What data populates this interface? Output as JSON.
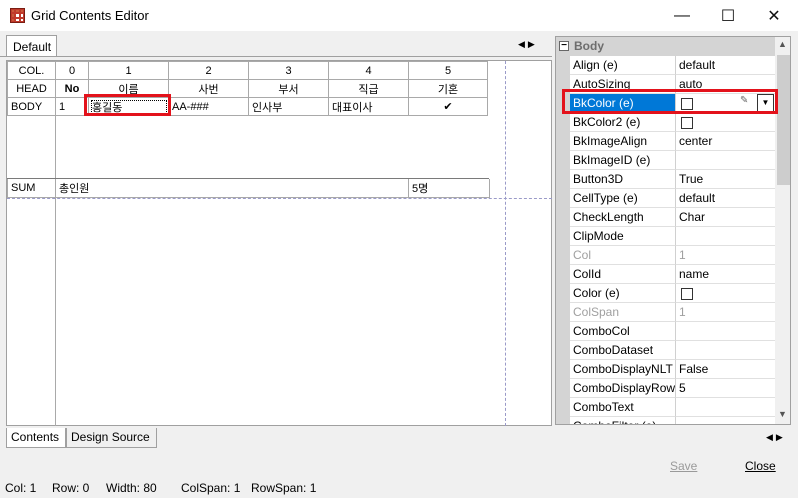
{
  "window": {
    "title": "Grid Contents Editor",
    "minimize": "—",
    "maximize": "☐",
    "close": "✕"
  },
  "top_tabs": [
    "Default"
  ],
  "grid": {
    "col_header_label": "COL.",
    "head_label": "HEAD",
    "body_label": "BODY",
    "sum_label": "SUM",
    "col_numbers": [
      "0",
      "1",
      "2",
      "3",
      "4",
      "5"
    ],
    "head_cells": [
      "No",
      "이름",
      "사번",
      "부서",
      "직급",
      "기혼"
    ],
    "body_cells": [
      "1",
      "홍길동",
      "AA-###",
      "인사부",
      "대표이사",
      "✔"
    ],
    "sum_cells": [
      "총인원",
      "5명"
    ]
  },
  "properties": {
    "group": "Body",
    "rows": [
      {
        "name": "Align (e)",
        "value": "default"
      },
      {
        "name": "AutoSizing",
        "value": "auto"
      },
      {
        "name": "BkColor (e)",
        "value": "",
        "checkbox": true,
        "selected": true
      },
      {
        "name": "BkColor2 (e)",
        "value": "",
        "checkbox": true
      },
      {
        "name": "BkImageAlign",
        "value": "center"
      },
      {
        "name": "BkImageID (e)",
        "value": ""
      },
      {
        "name": "Button3D",
        "value": "True"
      },
      {
        "name": "CellType (e)",
        "value": "default"
      },
      {
        "name": "CheckLength",
        "value": "Char"
      },
      {
        "name": "ClipMode",
        "value": ""
      },
      {
        "name": "Col",
        "value": "1",
        "disabled": true
      },
      {
        "name": "ColId",
        "value": "name"
      },
      {
        "name": "Color (e)",
        "value": "",
        "checkbox": true
      },
      {
        "name": "ColSpan",
        "value": "1",
        "disabled": true
      },
      {
        "name": "ComboCol",
        "value": ""
      },
      {
        "name": "ComboDataset",
        "value": ""
      },
      {
        "name": "ComboDisplayNLT",
        "value": "False"
      },
      {
        "name": "ComboDisplayRow",
        "value": "5"
      },
      {
        "name": "ComboText",
        "value": ""
      },
      {
        "name": "ComboFilter (e)",
        "value": ""
      }
    ]
  },
  "bottom_tabs": [
    "Contents",
    "Design Source"
  ],
  "buttons": {
    "save": "Save",
    "close": "Close"
  },
  "status": {
    "col": "Col: 1",
    "row": "Row: 0",
    "width": "Width: 80",
    "colspan": "ColSpan: 1",
    "rowspan": "RowSpan: 1"
  },
  "colors": {
    "selection": "#0078d7",
    "highlight_box": "#e3121b"
  }
}
